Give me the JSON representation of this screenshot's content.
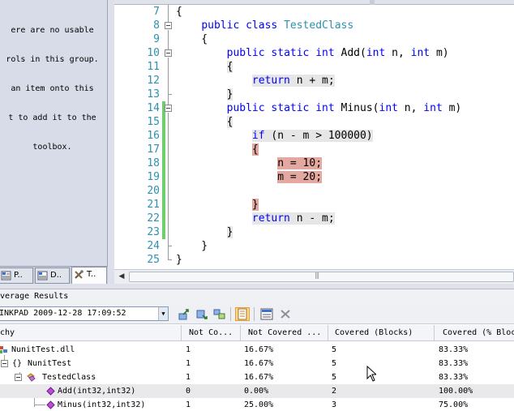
{
  "toolbox": {
    "empty_message_lines": [
      "ere are no usable",
      "rols in this group.",
      "an item onto this",
      "t to add it to the",
      "toolbox."
    ],
    "tabs": [
      {
        "label": "P.."
      },
      {
        "label": "D.."
      },
      {
        "label": "T.."
      }
    ]
  },
  "editor": {
    "lines": [
      {
        "n": "7",
        "code": "{"
      },
      {
        "n": "8",
        "code": "    public class TestedClass"
      },
      {
        "n": "9",
        "code": "    {"
      },
      {
        "n": "10",
        "code": "        public static int Add(int n, int m)"
      },
      {
        "n": "11",
        "code": "        {"
      },
      {
        "n": "12",
        "code": "            return n + m;"
      },
      {
        "n": "13",
        "code": "        }"
      },
      {
        "n": "14",
        "code": "        public static int Minus(int n, int m)"
      },
      {
        "n": "15",
        "code": "        {"
      },
      {
        "n": "16",
        "code": "            if (n - m > 100000)"
      },
      {
        "n": "17",
        "code": "            {"
      },
      {
        "n": "18",
        "code": "                n = 10;"
      },
      {
        "n": "19",
        "code": "                m = 20;"
      },
      {
        "n": "20",
        "code": ""
      },
      {
        "n": "21",
        "code": "            }"
      },
      {
        "n": "22",
        "code": "            return n - m;"
      },
      {
        "n": "23",
        "code": "        }"
      },
      {
        "n": "24",
        "code": "    }"
      },
      {
        "n": "25",
        "code": "}"
      }
    ],
    "tokens": {
      "public": "public",
      "class": "class",
      "static": "static",
      "int": "int",
      "if": "if",
      "return": "return",
      "class_name": "TestedClass",
      "add_sig": " Add(",
      "minus_sig": " Minus(",
      "params_mid": " n, ",
      "params_end": " m)",
      "add_body": " n + m;",
      "if_cond": " (n - m > 100000)",
      "n_assign": "n = 10;",
      "m_assign": "m = 20;",
      "minus_body": " n - m;"
    }
  },
  "results": {
    "title": "verage Results",
    "run_selected": "INKPAD 2009-12-28 17:09:52",
    "columns": [
      "chy",
      "Not Co...",
      "Not Covered ...",
      "Covered (Blocks)",
      "Covered (% Bloc"
    ],
    "rows": [
      {
        "name": "NunitTest.dll",
        "not_covered_blocks": "1",
        "not_covered_pct": "16.67%",
        "covered_blocks": "5",
        "covered_pct": "83.33%"
      },
      {
        "name": "NunitTest",
        "braces": "{}",
        "not_covered_blocks": "1",
        "not_covered_pct": "16.67%",
        "covered_blocks": "5",
        "covered_pct": "83.33%"
      },
      {
        "name": "TestedClass",
        "not_covered_blocks": "1",
        "not_covered_pct": "16.67%",
        "covered_blocks": "5",
        "covered_pct": "83.33%"
      },
      {
        "name": "Add(int32,int32)",
        "not_covered_blocks": "0",
        "not_covered_pct": "0.00%",
        "covered_blocks": "2",
        "covered_pct": "100.00%"
      },
      {
        "name": "Minus(int32,int32)",
        "not_covered_blocks": "1",
        "not_covered_pct": "25.00%",
        "covered_blocks": "3",
        "covered_pct": "75.00%"
      }
    ]
  },
  "colors": {
    "keyword": "#0000ff",
    "type": "#2b91af",
    "covered": "#e6e6e6",
    "not_covered": "#e4a8a0"
  }
}
